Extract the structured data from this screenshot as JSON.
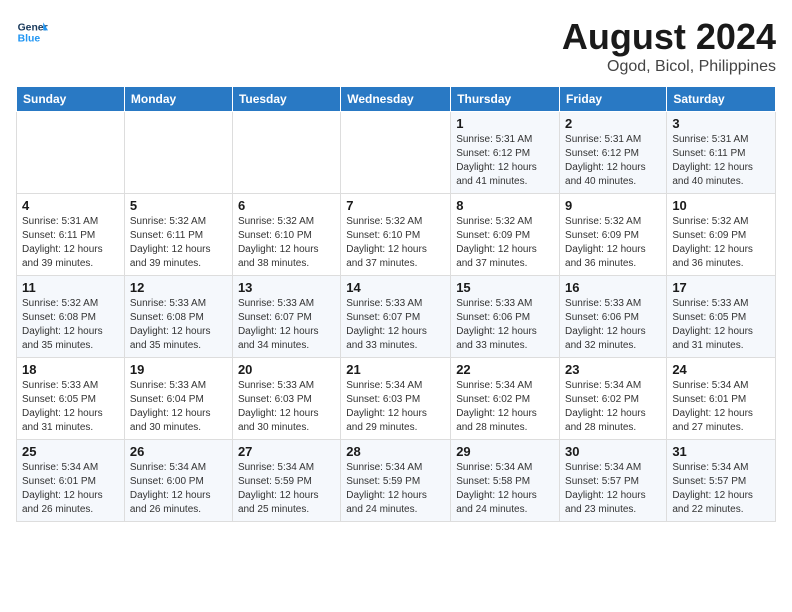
{
  "logo": {
    "line1": "General",
    "line2": "Blue"
  },
  "title": "August 2024",
  "subtitle": "Ogod, Bicol, Philippines",
  "days_header": [
    "Sunday",
    "Monday",
    "Tuesday",
    "Wednesday",
    "Thursday",
    "Friday",
    "Saturday"
  ],
  "weeks": [
    [
      {
        "num": "",
        "info": ""
      },
      {
        "num": "",
        "info": ""
      },
      {
        "num": "",
        "info": ""
      },
      {
        "num": "",
        "info": ""
      },
      {
        "num": "1",
        "info": "Sunrise: 5:31 AM\nSunset: 6:12 PM\nDaylight: 12 hours\nand 41 minutes."
      },
      {
        "num": "2",
        "info": "Sunrise: 5:31 AM\nSunset: 6:12 PM\nDaylight: 12 hours\nand 40 minutes."
      },
      {
        "num": "3",
        "info": "Sunrise: 5:31 AM\nSunset: 6:11 PM\nDaylight: 12 hours\nand 40 minutes."
      }
    ],
    [
      {
        "num": "4",
        "info": "Sunrise: 5:31 AM\nSunset: 6:11 PM\nDaylight: 12 hours\nand 39 minutes."
      },
      {
        "num": "5",
        "info": "Sunrise: 5:32 AM\nSunset: 6:11 PM\nDaylight: 12 hours\nand 39 minutes."
      },
      {
        "num": "6",
        "info": "Sunrise: 5:32 AM\nSunset: 6:10 PM\nDaylight: 12 hours\nand 38 minutes."
      },
      {
        "num": "7",
        "info": "Sunrise: 5:32 AM\nSunset: 6:10 PM\nDaylight: 12 hours\nand 37 minutes."
      },
      {
        "num": "8",
        "info": "Sunrise: 5:32 AM\nSunset: 6:09 PM\nDaylight: 12 hours\nand 37 minutes."
      },
      {
        "num": "9",
        "info": "Sunrise: 5:32 AM\nSunset: 6:09 PM\nDaylight: 12 hours\nand 36 minutes."
      },
      {
        "num": "10",
        "info": "Sunrise: 5:32 AM\nSunset: 6:09 PM\nDaylight: 12 hours\nand 36 minutes."
      }
    ],
    [
      {
        "num": "11",
        "info": "Sunrise: 5:32 AM\nSunset: 6:08 PM\nDaylight: 12 hours\nand 35 minutes."
      },
      {
        "num": "12",
        "info": "Sunrise: 5:33 AM\nSunset: 6:08 PM\nDaylight: 12 hours\nand 35 minutes."
      },
      {
        "num": "13",
        "info": "Sunrise: 5:33 AM\nSunset: 6:07 PM\nDaylight: 12 hours\nand 34 minutes."
      },
      {
        "num": "14",
        "info": "Sunrise: 5:33 AM\nSunset: 6:07 PM\nDaylight: 12 hours\nand 33 minutes."
      },
      {
        "num": "15",
        "info": "Sunrise: 5:33 AM\nSunset: 6:06 PM\nDaylight: 12 hours\nand 33 minutes."
      },
      {
        "num": "16",
        "info": "Sunrise: 5:33 AM\nSunset: 6:06 PM\nDaylight: 12 hours\nand 32 minutes."
      },
      {
        "num": "17",
        "info": "Sunrise: 5:33 AM\nSunset: 6:05 PM\nDaylight: 12 hours\nand 31 minutes."
      }
    ],
    [
      {
        "num": "18",
        "info": "Sunrise: 5:33 AM\nSunset: 6:05 PM\nDaylight: 12 hours\nand 31 minutes."
      },
      {
        "num": "19",
        "info": "Sunrise: 5:33 AM\nSunset: 6:04 PM\nDaylight: 12 hours\nand 30 minutes."
      },
      {
        "num": "20",
        "info": "Sunrise: 5:33 AM\nSunset: 6:03 PM\nDaylight: 12 hours\nand 30 minutes."
      },
      {
        "num": "21",
        "info": "Sunrise: 5:34 AM\nSunset: 6:03 PM\nDaylight: 12 hours\nand 29 minutes."
      },
      {
        "num": "22",
        "info": "Sunrise: 5:34 AM\nSunset: 6:02 PM\nDaylight: 12 hours\nand 28 minutes."
      },
      {
        "num": "23",
        "info": "Sunrise: 5:34 AM\nSunset: 6:02 PM\nDaylight: 12 hours\nand 28 minutes."
      },
      {
        "num": "24",
        "info": "Sunrise: 5:34 AM\nSunset: 6:01 PM\nDaylight: 12 hours\nand 27 minutes."
      }
    ],
    [
      {
        "num": "25",
        "info": "Sunrise: 5:34 AM\nSunset: 6:01 PM\nDaylight: 12 hours\nand 26 minutes."
      },
      {
        "num": "26",
        "info": "Sunrise: 5:34 AM\nSunset: 6:00 PM\nDaylight: 12 hours\nand 26 minutes."
      },
      {
        "num": "27",
        "info": "Sunrise: 5:34 AM\nSunset: 5:59 PM\nDaylight: 12 hours\nand 25 minutes."
      },
      {
        "num": "28",
        "info": "Sunrise: 5:34 AM\nSunset: 5:59 PM\nDaylight: 12 hours\nand 24 minutes."
      },
      {
        "num": "29",
        "info": "Sunrise: 5:34 AM\nSunset: 5:58 PM\nDaylight: 12 hours\nand 24 minutes."
      },
      {
        "num": "30",
        "info": "Sunrise: 5:34 AM\nSunset: 5:57 PM\nDaylight: 12 hours\nand 23 minutes."
      },
      {
        "num": "31",
        "info": "Sunrise: 5:34 AM\nSunset: 5:57 PM\nDaylight: 12 hours\nand 22 minutes."
      }
    ]
  ]
}
